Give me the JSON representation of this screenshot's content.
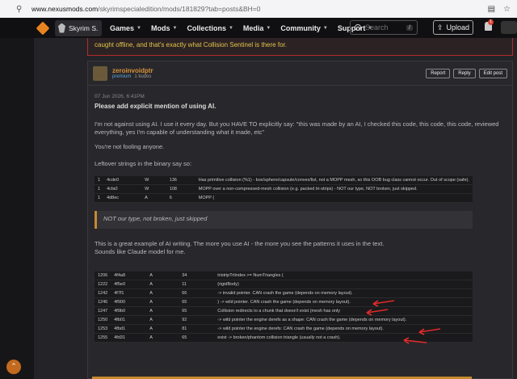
{
  "browser": {
    "url_host": "www.nexusmods.com",
    "url_path": "/skyrimspecialedition/mods/181829?tab=posts&BH=0"
  },
  "nav": {
    "game_tab": "Skyrim S...",
    "menu": [
      "Games",
      "Mods",
      "Collections",
      "Media",
      "Community",
      "Support"
    ],
    "search_placeholder": "Search",
    "search_kbd": "/",
    "upload_label": "Upload",
    "notif_count": "1"
  },
  "warning_text": "caught offline, and that's exactly what Collision Sentinel is there for.",
  "post": {
    "username": "zeroinvoidptr",
    "premium": "premium",
    "kudos": "1 kudos",
    "actions": [
      "Report",
      "Reply",
      "Edit post"
    ],
    "date": "07 Jun 2026, 6:41PM",
    "title": "Please add explicit mention of using AI.",
    "para1": "I'm not against using AI. I use it every day. But you HAVE TO explicitly say: \"this was made by an AI, I checked this code, this code, this code, reviewed everything, yes I'm capable of understanding what it made, etc\"",
    "para2": "You're not fooling anyone.",
    "para3": "Leftover strings in the binary say so:",
    "table1": [
      [
        "1",
        "4cde0",
        "W",
        "136",
        "Has primitive collision (%1) - box/sphere/capsule/convex/list, not a MOPP mesh, so this OOB bug class cannot occur. Out of scope (safe)."
      ],
      [
        "1",
        "4cfa0",
        "W",
        "108",
        "MOPP over a non-compressed-mesh collision (e.g. packed tri-strips) - NOT our type, NOT broken, just skipped."
      ],
      [
        "1",
        "4d8ec",
        "A",
        "6",
        "MOPP ("
      ]
    ],
    "quote": "NOT our type, not broken, just skipped",
    "para4": "This is a great example of AI writing. The more you use AI - the more you see the patterns it uses in the text.",
    "para5": "Sounds like Claude model for me.",
    "table2": [
      [
        "1206",
        "4f4a8",
        "A",
        "34",
        "tristripTriIndex >= NumTriangles ("
      ],
      [
        "1222",
        "4f5e0",
        "A",
        "11",
        "(rigidBody)"
      ],
      [
        "1242",
        "4f7f1",
        "A",
        "66",
        "-> invalid pointer. CAN crash the game (depends on memory layout)."
      ],
      [
        "1246",
        "4f900",
        "A",
        "65",
        ") -> wild pointer. CAN crash the game (depends on memory layout)."
      ],
      [
        "1247",
        "4f9b0",
        "A",
        "65",
        "Collision redirects to a chunk that doesn't exist (mesh has only"
      ],
      [
        "1250",
        "4fb01",
        "A",
        "92",
        "-> wild pointer the engine derefs as a shape: CAN crash the game (depends on memory layout)."
      ],
      [
        "1253",
        "4fbd1",
        "A",
        "81",
        "-> wild pointer the engine derefs: CAN crash the game (depends on memory layout)."
      ],
      [
        "1255",
        "4fd31",
        "A",
        "65",
        "exist -> broken/phantom collision triangle (usually not a crash)."
      ]
    ]
  },
  "colors": {
    "accent": "#d79239",
    "alert": "#e02a2a",
    "warning_border": "#b42a2a"
  }
}
